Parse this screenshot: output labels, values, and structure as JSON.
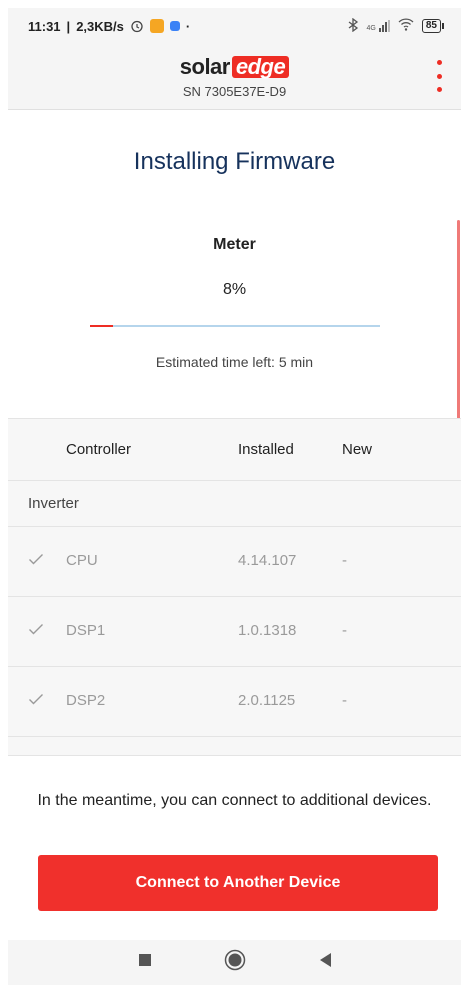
{
  "status_bar": {
    "time": "11:31",
    "speed": "2,3KB/s",
    "battery": "85",
    "network": "4G"
  },
  "app_bar": {
    "logo_solar": "solar",
    "logo_edge": "edge",
    "serial": "SN 7305E37E-D9"
  },
  "main": {
    "title": "Installing Firmware",
    "device": "Meter",
    "percent": "8%",
    "progress": 0.08,
    "eta": "Estimated time left: 5 min"
  },
  "table": {
    "headers": {
      "controller": "Controller",
      "installed": "Installed",
      "new": "New"
    },
    "group": "Inverter",
    "rows": [
      {
        "name": "CPU",
        "installed": "4.14.107",
        "new": "-"
      },
      {
        "name": "DSP1",
        "installed": "1.0.1318",
        "new": "-"
      },
      {
        "name": "DSP2",
        "installed": "2.0.1125",
        "new": "-"
      }
    ]
  },
  "footer": {
    "message": "In the meantime, you can connect to additional devices.",
    "button": "Connect to Another Device"
  },
  "colors": {
    "brand_red": "#ee2d24",
    "title_blue": "#16325c",
    "progress_track": "#b5d5ec"
  },
  "icons": [
    "alarm-icon",
    "bluetooth-icon",
    "signal-icon",
    "wifi-icon",
    "battery-icon",
    "more-vert-icon",
    "check-icon",
    "recents-icon",
    "home-icon",
    "back-icon"
  ]
}
